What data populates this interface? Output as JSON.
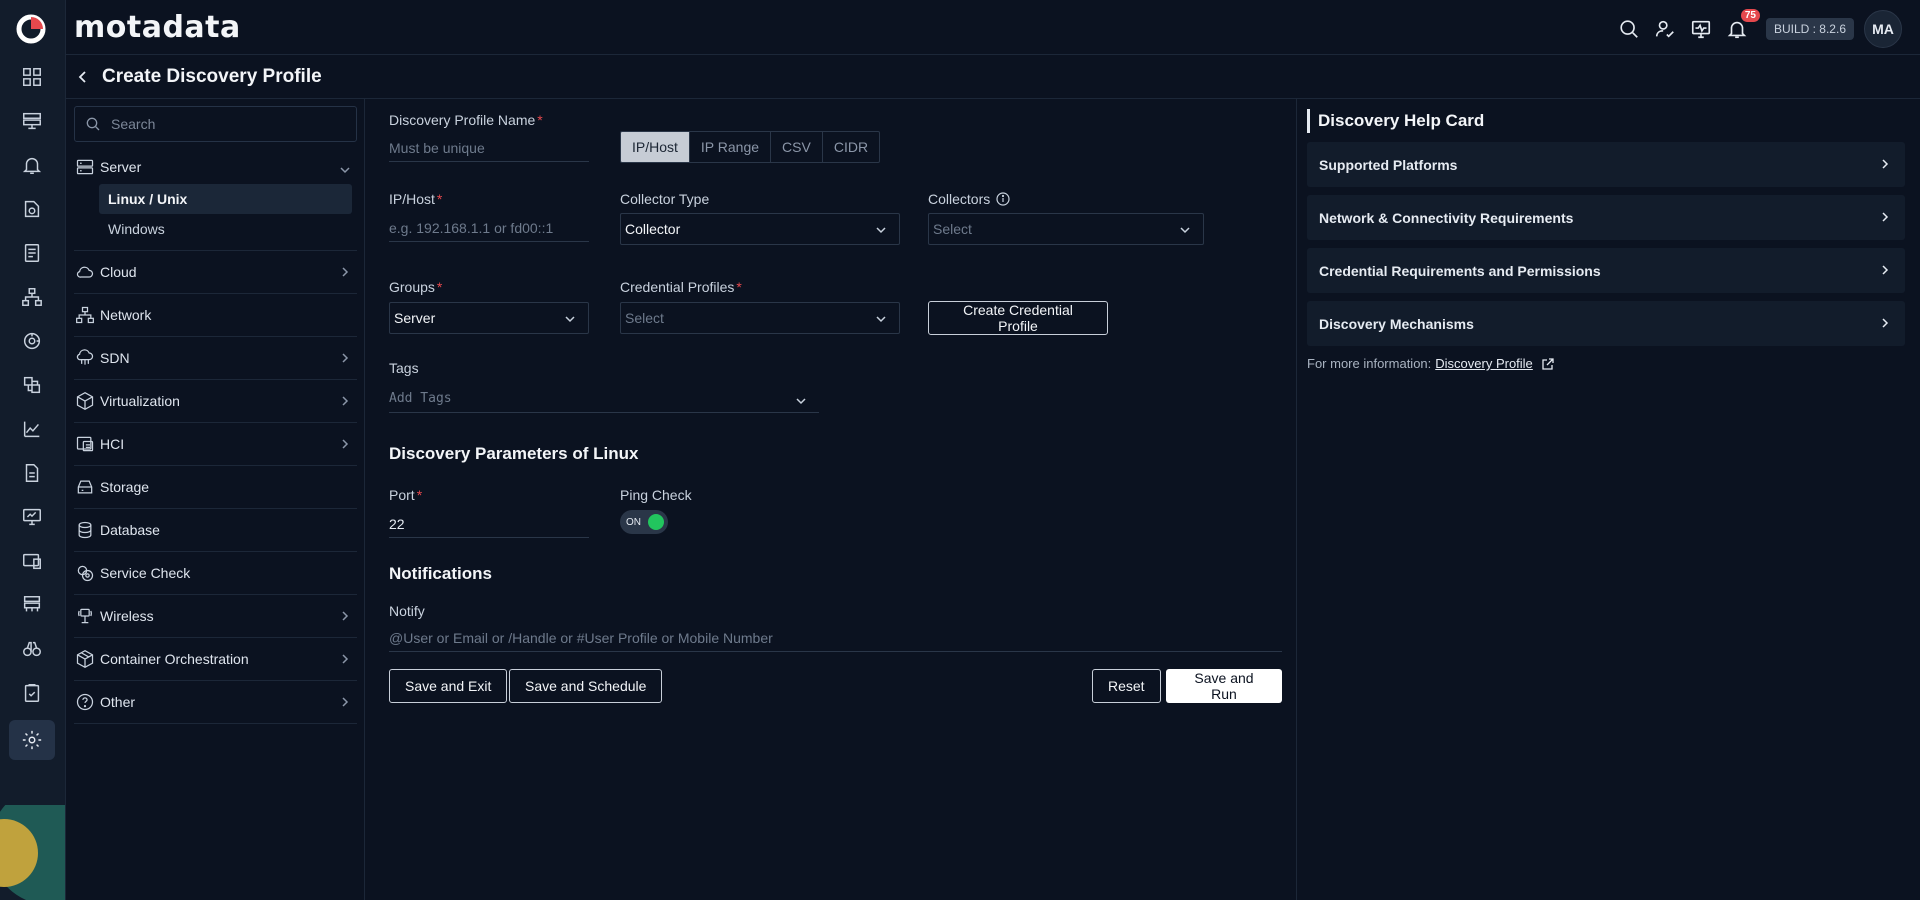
{
  "app": {
    "brand": "motadata",
    "build": "BUILD : 8.2.6",
    "avatar_initials": "MA",
    "notification_count": "75"
  },
  "rail": {
    "icons": [
      "dashboard-icon",
      "monitor-rack-icon",
      "alert-bell-icon",
      "flow-icon",
      "log-icon",
      "topology-icon",
      "apm-icon",
      "config-icon",
      "metric-explorer-icon",
      "report-icon",
      "screen-monitor-icon",
      "audit-icon",
      "network-map-icon",
      "binoculars-icon",
      "compliance-icon",
      "settings-icon"
    ],
    "active": "settings-icon"
  },
  "page": {
    "title": "Create Discovery Profile"
  },
  "search": {
    "placeholder": "Search"
  },
  "categories": [
    {
      "label": "Server",
      "icon": "server-icon",
      "open": true,
      "sub": [
        "Linux / Unix",
        "Windows"
      ],
      "active_sub": "Linux / Unix"
    },
    {
      "label": "Cloud",
      "icon": "cloud-icon",
      "chevron": true
    },
    {
      "label": "Network",
      "icon": "network-icon",
      "chevron": false
    },
    {
      "label": "SDN",
      "icon": "sdn-icon",
      "chevron": true
    },
    {
      "label": "Virtualization",
      "icon": "cube-icon",
      "chevron": true
    },
    {
      "label": "HCI",
      "icon": "hci-icon",
      "chevron": true
    },
    {
      "label": "Storage",
      "icon": "storage-icon",
      "chevron": false
    },
    {
      "label": "Database",
      "icon": "database-icon",
      "chevron": false
    },
    {
      "label": "Service Check",
      "icon": "service-check-icon",
      "chevron": false
    },
    {
      "label": "Wireless",
      "icon": "wireless-icon",
      "chevron": true
    },
    {
      "label": "Container Orchestration",
      "icon": "container-icon",
      "chevron": true
    },
    {
      "label": "Other",
      "icon": "question-icon",
      "chevron": true
    }
  ],
  "form": {
    "profile_name": {
      "label": "Discovery Profile Name",
      "placeholder": "Must be unique"
    },
    "modes": [
      "IP/Host",
      "IP Range",
      "CSV",
      "CIDR"
    ],
    "active_mode": "IP/Host",
    "ip_host": {
      "label": "IP/Host",
      "placeholder": "e.g. 192.168.1.1 or fd00::1"
    },
    "collector_type": {
      "label": "Collector Type",
      "value": "Collector"
    },
    "collectors": {
      "label": "Collectors",
      "value": "Select"
    },
    "groups": {
      "label": "Groups",
      "value": "Server"
    },
    "credential_profiles": {
      "label": "Credential Profiles",
      "value": "Select"
    },
    "create_credential_label": "Create Credential Profile",
    "tags": {
      "label": "Tags",
      "placeholder": "Add Tags"
    },
    "params_title": "Discovery Parameters of Linux",
    "port": {
      "label": "Port",
      "value": "22"
    },
    "ping_check": {
      "label": "Ping Check",
      "state": "ON"
    },
    "notifications_title": "Notifications",
    "notify": {
      "label": "Notify",
      "placeholder": "@User or Email or /Handle or #User Profile or Mobile Number"
    },
    "buttons": {
      "save_exit": "Save and Exit",
      "save_schedule": "Save and Schedule",
      "reset": "Reset",
      "save_run": "Save and Run"
    }
  },
  "help": {
    "title": "Discovery Help Card",
    "cards": [
      "Supported Platforms",
      "Network & Connectivity Requirements",
      "Credential Requirements and Permissions",
      "Discovery Mechanisms"
    ],
    "more_text": "For more information:",
    "more_link": "Discovery Profile"
  },
  "colors": {
    "background": "#0b1220",
    "panel": "#121c2b",
    "accent_required": "#e5484d",
    "toggle_on": "#22c55e",
    "badge": "#e5484d"
  }
}
